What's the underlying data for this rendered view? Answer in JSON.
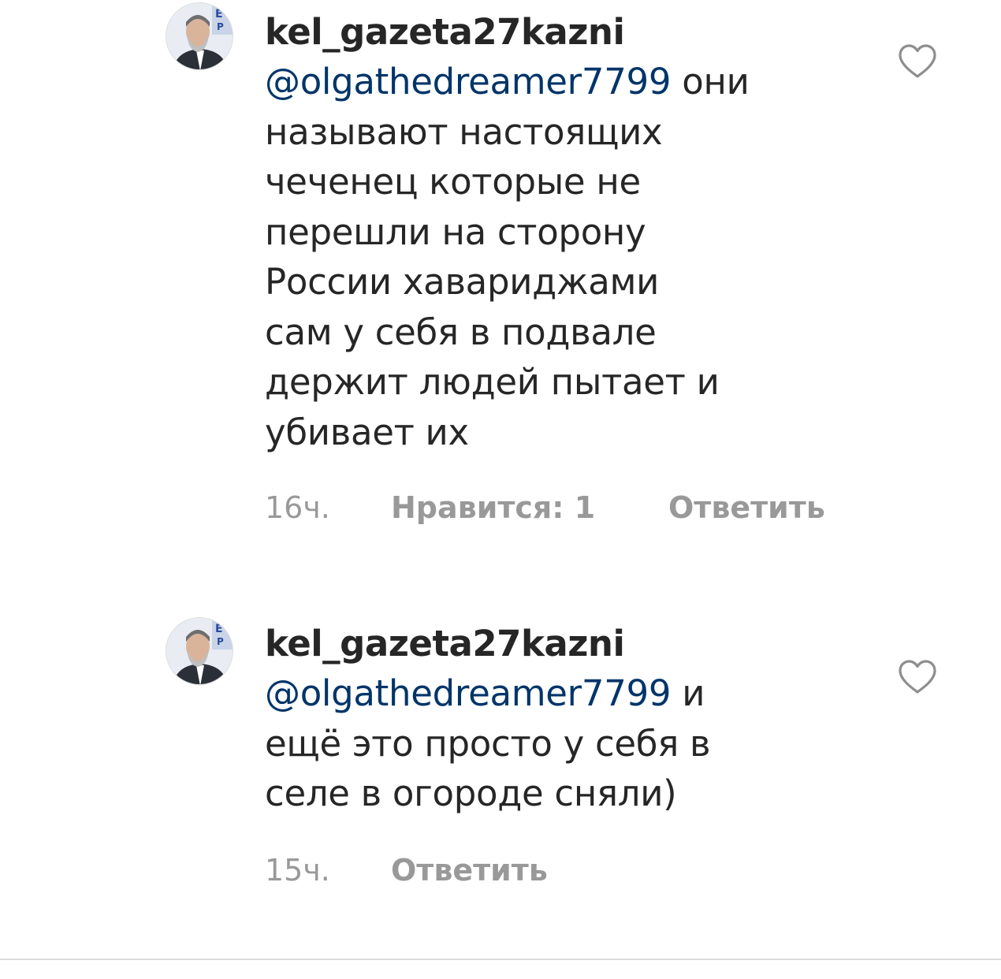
{
  "comments": [
    {
      "username": "kel_gazeta27kazni",
      "mention": "@olgathedreamer7799",
      "first_line_rest": " они",
      "lines": [
        "называют настоящих",
        "чеченец которые не",
        "перешли на сторону",
        "России хавариджами",
        "сам у себя в подвале",
        "держит людей пытает и",
        "убивает их"
      ],
      "time": "16ч.",
      "likes": "Нравится: 1",
      "reply": "Ответить"
    },
    {
      "username": "kel_gazeta27kazni",
      "mention": "@olgathedreamer7799",
      "first_line_rest": " и",
      "lines": [
        "ещё это просто у себя в",
        "селе в  огороде сняли)"
      ],
      "time": "15ч.",
      "reply": "Ответить"
    }
  ],
  "icons": {
    "heart": "heart-outline-icon",
    "avatar": "avatar-image"
  },
  "colors": {
    "text": "#262626",
    "mention": "#003569",
    "meta": "#999999",
    "divider": "#dbdbdb"
  }
}
